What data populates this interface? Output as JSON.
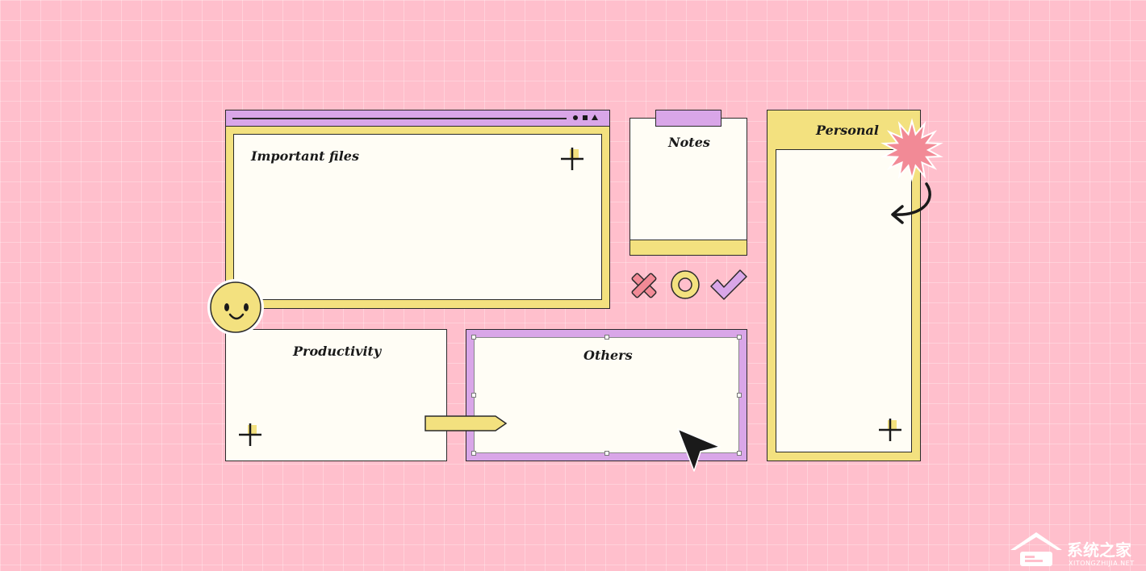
{
  "cards": {
    "important_files": "Important files",
    "notes": "Notes",
    "personal": "Personal",
    "productivity": "Productivity",
    "others": "Others"
  },
  "watermark": {
    "text": "系统之家",
    "subtext": "XITONGZHIJIA.NET"
  },
  "colors": {
    "background": "#ffbfcc",
    "yellow": "#f3e17f",
    "purple": "#d9a6e8",
    "paper": "#fffdf5",
    "pink_accent": "#f28a96"
  },
  "icons": [
    "plus-sparkle-icon",
    "smiley-icon",
    "x-mark-icon",
    "circle-icon",
    "checkmark-icon",
    "starburst-icon",
    "curved-arrow-icon",
    "cursor-icon",
    "tag-arrow-icon"
  ]
}
